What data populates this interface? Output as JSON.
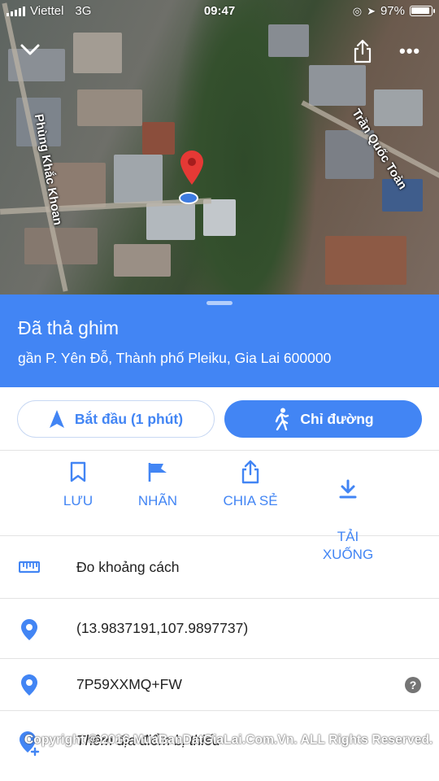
{
  "status_bar": {
    "carrier": "Viettel",
    "network": "3G",
    "time": "09:47",
    "battery": "97%"
  },
  "map": {
    "streets": [
      "Phùng Khắc Khoan",
      "Trần Quốc Toản"
    ]
  },
  "place": {
    "title": "Đã thả ghim",
    "address": "gần P. Yên Đỗ, Thành phố Pleiku, Gia Lai 600000"
  },
  "actions": {
    "start_label": "Bắt đầu (1 phút)",
    "directions_label": "Chỉ đường"
  },
  "quick_actions": [
    {
      "label": "LƯU",
      "icon": "bookmark-icon"
    },
    {
      "label": "NHÃN",
      "icon": "flag-icon"
    },
    {
      "label": "CHIA SẺ",
      "icon": "share-icon"
    },
    {
      "label": "TẢI\nXUỐNG",
      "icon": "download-icon"
    }
  ],
  "details": {
    "measure_distance": "Đo khoảng cách",
    "coordinates": "(13.9837191,107.9897737)",
    "plus_code": "7P59XXMQ+FW",
    "add_missing_place": "Thêm địa điểm bị thiếu"
  },
  "watermark": {
    "copyright": "Copyright © 2016 MuaBanDatGiaLai.Com.Vn. ALL Rights Reserved."
  },
  "colors": {
    "accent": "#4285f4",
    "pin": "#e53935"
  }
}
